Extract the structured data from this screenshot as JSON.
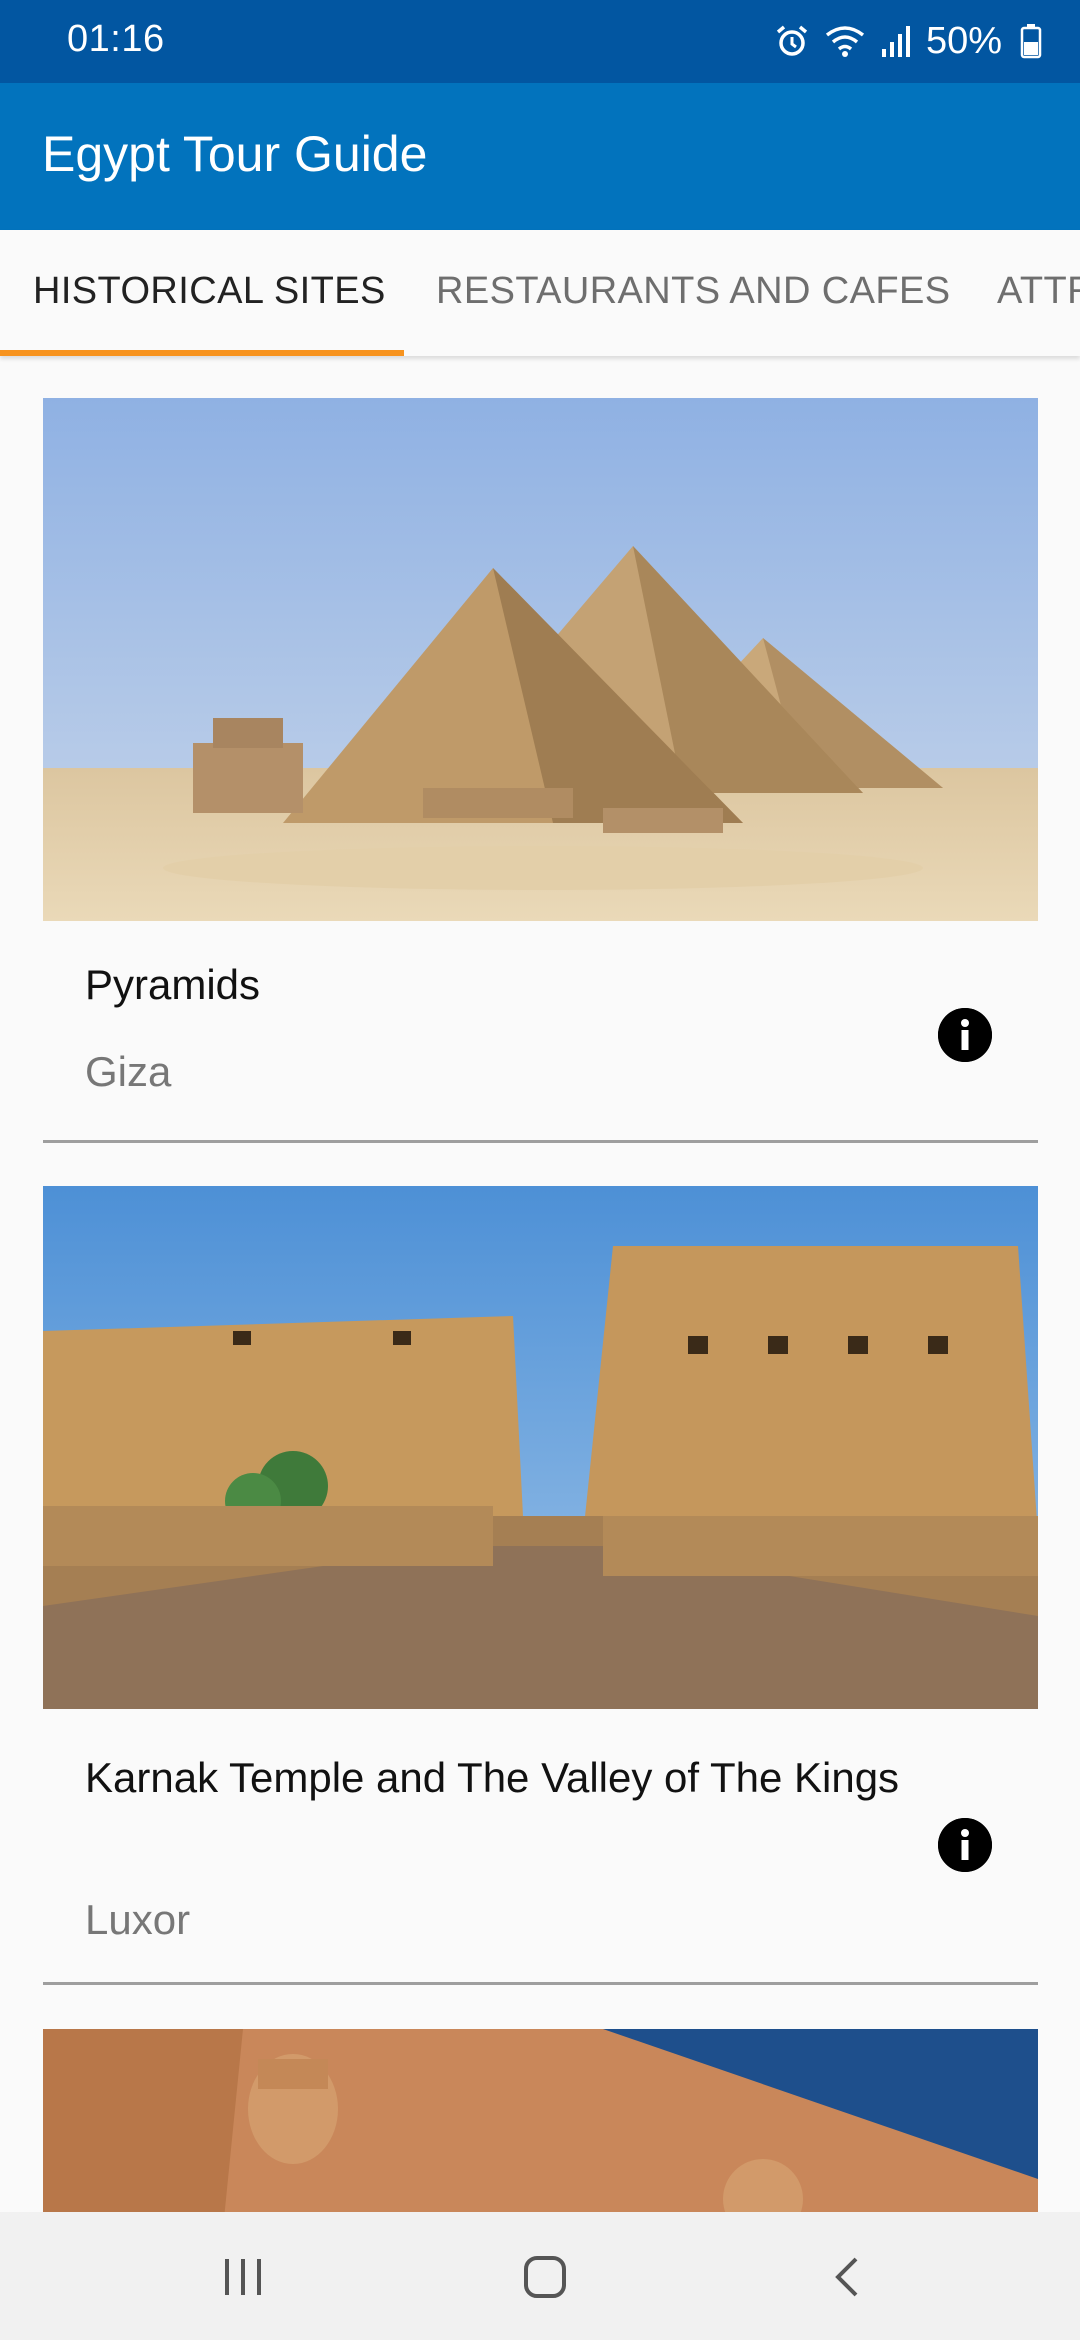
{
  "status_bar": {
    "time": "01:16",
    "battery": "50%",
    "icons": [
      "alarm-icon",
      "wifi-icon",
      "signal-icon",
      "battery-icon"
    ]
  },
  "app_bar": {
    "title": "Egypt Tour Guide",
    "color": "#0273bd"
  },
  "tabs": [
    {
      "label": "HISTORICAL SITES",
      "selected": true
    },
    {
      "label": "RESTAURANTS AND CAFES",
      "selected": false
    },
    {
      "label": "ATTR",
      "selected": false
    }
  ],
  "accent_color": "#f7931e",
  "sites": [
    {
      "title": "Pyramids",
      "location": "Giza",
      "image": "pyramids-photo",
      "info_icon": "info-icon"
    },
    {
      "title": "Karnak Temple and The Valley of The Kings",
      "location": "Luxor",
      "image": "karnak-temple-photo",
      "info_icon": "info-icon"
    },
    {
      "image": "abu-simbel-photo"
    }
  ],
  "nav_bar": {
    "icons": [
      "recent-apps-icon",
      "home-icon",
      "back-icon"
    ]
  }
}
